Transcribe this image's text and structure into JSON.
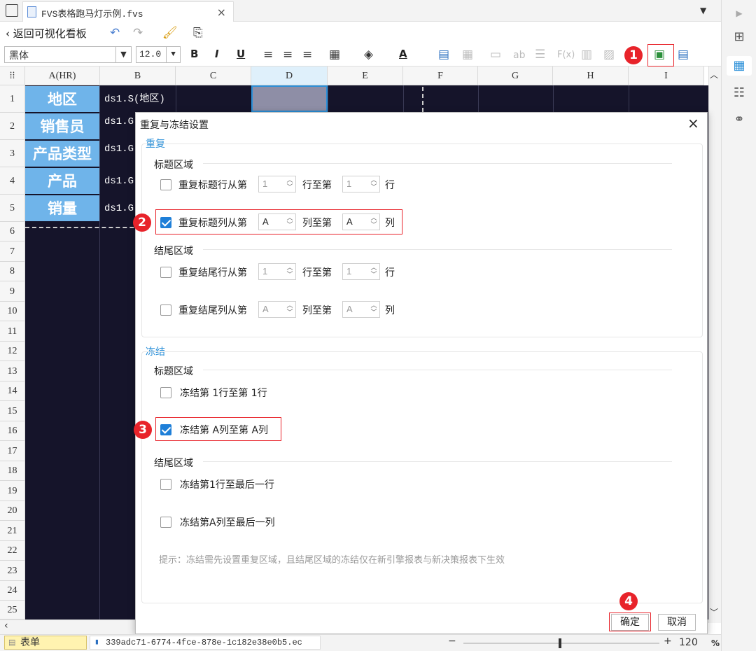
{
  "tab": {
    "title": "FVS表格跑马灯示例.fvs",
    "close": "×"
  },
  "toolbar1": {
    "back_label": "返回可视化看板"
  },
  "toolbar2": {
    "font": "黑体",
    "font_size": "12.0",
    "bold": "B",
    "italic": "I",
    "underline": "U",
    "font_color_glyph": "A",
    "text_ab": "ab",
    "formula": "F(x)"
  },
  "grid": {
    "columns": [
      "A(HR)",
      "B",
      "C",
      "D",
      "E",
      "F",
      "G",
      "H",
      "I"
    ],
    "rows": [
      "1",
      "2",
      "3",
      "4",
      "5",
      "6",
      "7",
      "8",
      "9",
      "10",
      "11",
      "12",
      "13",
      "14",
      "15",
      "16",
      "17",
      "18",
      "19",
      "20",
      "21",
      "22",
      "23",
      "24",
      "25"
    ],
    "col_a_cells": [
      "地区",
      "销售员",
      "产品类型",
      "产品",
      "销量"
    ],
    "col_b_cells": [
      "ds1.S(地区)",
      "ds1.G",
      "ds1.G",
      "ds1.G",
      "ds1.G"
    ]
  },
  "badges": [
    "1",
    "2",
    "3",
    "4"
  ],
  "dialog": {
    "title": "重复与冻结设置",
    "close": "×",
    "repeat_section": "重复",
    "title_area": "标题区域",
    "repeat_title_row": {
      "label_pre": "重复标题行从第",
      "from": "1",
      "mid": "行至第",
      "to": "1",
      "post": "行",
      "checked": false
    },
    "repeat_title_col": {
      "label_pre": "重复标题列从第",
      "from": "A",
      "mid": "列至第",
      "to": "A",
      "post": "列",
      "checked": true
    },
    "tail_area": "结尾区域",
    "repeat_tail_row": {
      "label_pre": "重复结尾行从第",
      "from": "1",
      "mid": "行至第",
      "to": "1",
      "post": "行",
      "checked": false
    },
    "repeat_tail_col": {
      "label_pre": "重复结尾列从第",
      "from": "A",
      "mid": "列至第",
      "to": "A",
      "post": "列",
      "checked": false
    },
    "freeze_section": "冻结",
    "freeze_title_area": "标题区域",
    "freeze_row": {
      "label": "冻结第 1行至第  1行",
      "checked": false
    },
    "freeze_col": {
      "label": "冻结第 A列至第  A列",
      "checked": true
    },
    "freeze_tail_area": "结尾区域",
    "freeze_tail_row": {
      "label": "冻结第1行至最后一行",
      "checked": false
    },
    "freeze_tail_col": {
      "label": "冻结第A列至最后一列",
      "checked": false
    },
    "tip": "提示：冻结需先设置重复区域，且结尾区域的冻结仅在新引擎报表与新决策报表下生效",
    "ok": "确定",
    "cancel": "取消"
  },
  "statusbar": {
    "sheet_tab": "表单",
    "file_tab": "339adc71-6774-4fce-878e-1c182e38e0b5.ec",
    "zoom": "120",
    "zoom_unit": "%",
    "minus": "−",
    "plus": "+"
  },
  "colors": {
    "accent": "#1e7fd8",
    "badge": "#e8232a",
    "header_cell": "#6fb4ea",
    "dark_bg": "#15142a"
  }
}
